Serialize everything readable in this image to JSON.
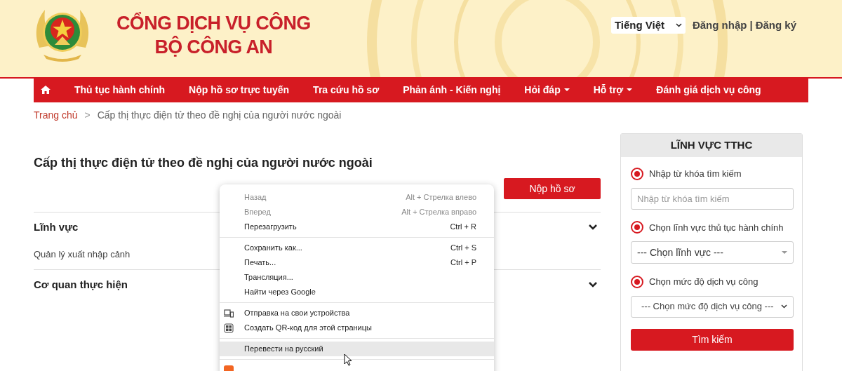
{
  "header": {
    "title_lines": [
      "CỔNG DỊCH VỤ CÔNG",
      "BỘ CÔNG AN"
    ],
    "language": "Tiếng Việt",
    "login": "Đăng nhập",
    "separator": "|",
    "register": "Đăng ký"
  },
  "nav": [
    {
      "label": "Thủ tục hành chính",
      "dropdown": false
    },
    {
      "label": "Nộp hồ sơ trực tuyến",
      "dropdown": false
    },
    {
      "label": "Tra cứu hồ sơ",
      "dropdown": false
    },
    {
      "label": "Phản ánh - Kiến nghị",
      "dropdown": false
    },
    {
      "label": "Hỏi đáp",
      "dropdown": true
    },
    {
      "label": "Hỗ trợ",
      "dropdown": true
    },
    {
      "label": "Đánh giá dịch vụ công",
      "dropdown": false
    }
  ],
  "breadcrumb": {
    "home": "Trang chủ",
    "separator": ">",
    "current": "Cấp thị thực điện tử theo đề nghị của người nước ngoài"
  },
  "page_title": "Cấp thị thực điện tử theo đề nghị của người nước ngoài",
  "submit_button": "Nộp hồ sơ",
  "sections": [
    {
      "title": "Lĩnh vực",
      "value": "Quản lý xuất nhập cảnh"
    },
    {
      "title": "Cơ quan thực hiện"
    }
  ],
  "sidebar": {
    "title": "LĨNH VỰC TTHC",
    "groups": [
      {
        "kind": "input",
        "label": "Nhập từ khóa tìm kiếm",
        "checked": true,
        "placeholder": "Nhập từ khóa tìm kiếm"
      },
      {
        "kind": "select",
        "label": "Chọn lĩnh vực thủ tục hành chính",
        "checked": true,
        "value": "--- Chọn lĩnh vực ---"
      },
      {
        "kind": "native_select",
        "label": "Chọn mức độ dịch vụ công",
        "checked": true,
        "value": "--- Chọn mức độ dịch vụ công ---"
      }
    ],
    "button": "Tìm kiếm"
  },
  "context_menu": {
    "groups": [
      [
        {
          "kind": "plain",
          "label": "Назад",
          "shortcut": "Alt + Стрелка влево",
          "disabled": true,
          "selected": false
        },
        {
          "kind": "plain",
          "label": "Вперед",
          "shortcut": "Alt + Стрелка вправо",
          "disabled": true,
          "selected": false
        },
        {
          "kind": "plain",
          "label": "Перезагрузить",
          "shortcut": "Ctrl + R",
          "disabled": false,
          "selected": false
        }
      ],
      [
        {
          "kind": "plain",
          "label": "Сохранить как...",
          "shortcut": "Ctrl + S",
          "disabled": false,
          "selected": false
        },
        {
          "kind": "plain",
          "label": "Печать...",
          "shortcut": "Ctrl + P",
          "disabled": false,
          "selected": false
        },
        {
          "kind": "plain",
          "label": "Трансляция...",
          "disabled": false,
          "selected": false
        },
        {
          "kind": "plain",
          "label": "Найти через Google",
          "disabled": false,
          "selected": false
        }
      ],
      [
        {
          "kind": "devices",
          "label": "Отправка на свои устройства",
          "disabled": false,
          "selected": false
        },
        {
          "kind": "qr",
          "label": "Создать QR-код для этой страницы",
          "disabled": false,
          "selected": false
        }
      ],
      [
        {
          "kind": "plain",
          "label": "Перевести на русский",
          "disabled": false,
          "selected": true
        }
      ],
      [
        {
          "kind": "extension"
        }
      ]
    ]
  }
}
